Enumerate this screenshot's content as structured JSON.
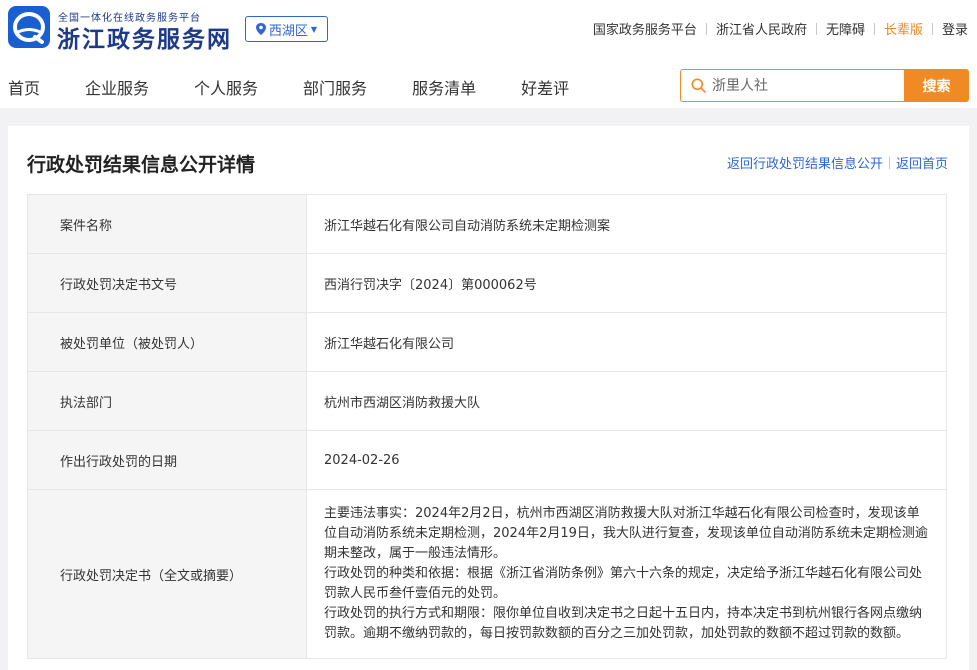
{
  "header": {
    "site_subtitle": "全国一体化在线政务服务平台",
    "site_name": "浙江政务服务网",
    "region": "西湖区",
    "top_links": {
      "national": "国家政务服务平台",
      "province": "浙江省人民政府",
      "accessible": "无障碍",
      "elder": "长辈版",
      "login": "登录"
    },
    "nav": [
      "首页",
      "企业服务",
      "个人服务",
      "部门服务",
      "服务清单",
      "好差评"
    ],
    "search": {
      "placeholder": "浙里人社",
      "button": "搜索"
    }
  },
  "colors": {
    "brand_blue": "#1a5fd0",
    "accent_orange": "#f08a24",
    "link_blue": "#2f66d6"
  },
  "page": {
    "title": "行政处罚结果信息公开详情",
    "back_list": "返回行政处罚结果信息公开",
    "back_home": "返回首页"
  },
  "rows": [
    {
      "label": "案件名称",
      "value": "浙江华越石化有限公司自动消防系统未定期检测案"
    },
    {
      "label": "行政处罚决定书文号",
      "value": "西消行罚决字〔2024〕第000062号"
    },
    {
      "label": "被处罚单位（被处罚人）",
      "value": "浙江华越石化有限公司"
    },
    {
      "label": "执法部门",
      "value": "杭州市西湖区消防救援大队"
    },
    {
      "label": "作出行政处罚的日期",
      "value": "2024-02-26"
    }
  ],
  "decision": {
    "label": "行政处罚决定书（全文或摘要）",
    "paragraphs": [
      "主要违法事实：2024年2月2日，杭州市西湖区消防救援大队对浙江华越石化有限公司检查时，发现该单位自动消防系统未定期检测，2024年2月19日，我大队进行复查，发现该单位自动消防系统未定期检测逾期未整改，属于一般违法情形。",
      "行政处罚的种类和依据：根据《浙江省消防条例》第六十六条的规定，决定给予浙江华越石化有限公司处罚款人民币叁仟壹佰元的处罚。",
      "行政处罚的执行方式和期限：限你单位自收到决定书之日起十五日内，持本决定书到杭州银行各网点缴纳罚款。逾期不缴纳罚款的，每日按罚款数额的百分之三加处罚款，加处罚款的数额不超过罚款的数额。"
    ]
  }
}
